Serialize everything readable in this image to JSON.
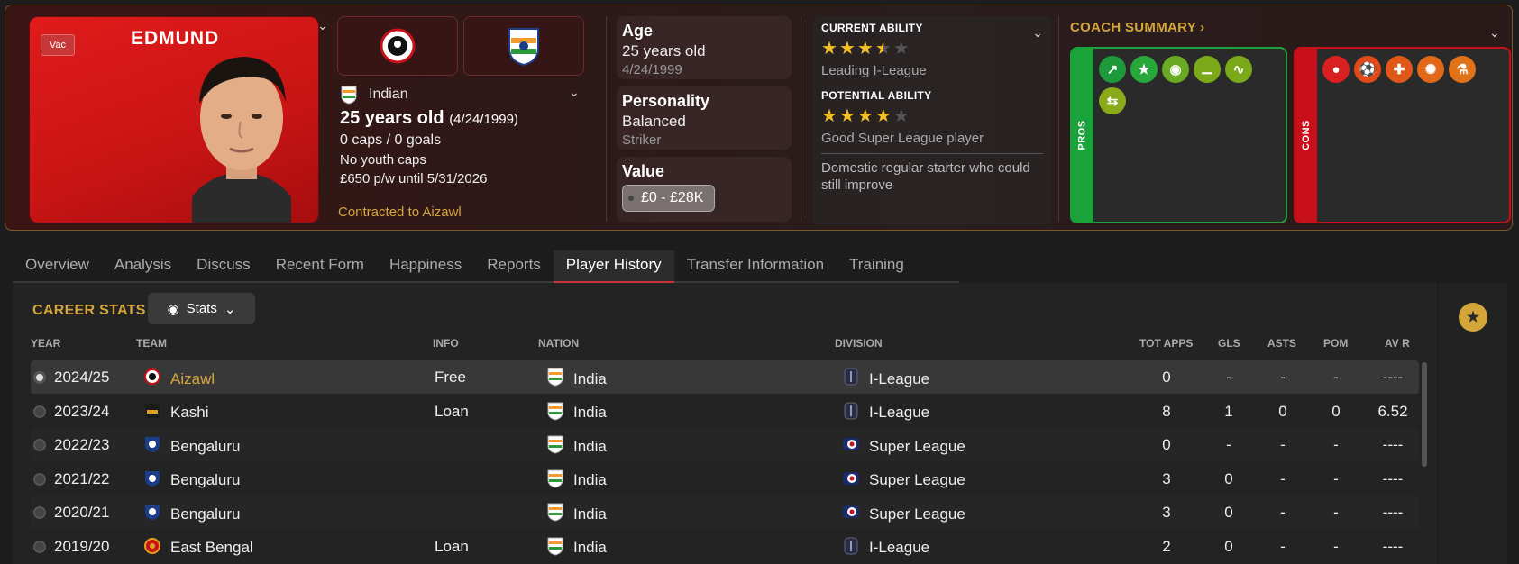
{
  "profile": {
    "name": "EDMUND",
    "vac_badge": "Vac",
    "nationality": "Indian",
    "age_line": "25 years old",
    "dob_paren": "(4/24/1999)",
    "caps_goals": "0 caps / 0 goals",
    "youth_caps": "No youth caps",
    "wage": "£650 p/w until 5/31/2026",
    "contract": "Contracted to Aizawl"
  },
  "info": {
    "age_label": "Age",
    "age_value": "25 years old",
    "dob": "4/24/1999",
    "personality_label": "Personality",
    "personality_value": "Balanced",
    "position": "Striker",
    "value_label": "Value",
    "value_range": "£0 - £28K"
  },
  "ability": {
    "current_label": "CURRENT ABILITY",
    "current_stars": 3.5,
    "current_desc": "Leading I-League",
    "potential_label": "POTENTIAL ABILITY",
    "potential_stars": 4,
    "potential_desc": "Good Super League player",
    "summary": "Domestic regular starter who could still improve"
  },
  "coach": {
    "title": "COACH SUMMARY",
    "pros_label": "PROS",
    "cons_label": "CONS",
    "pros_icons": [
      "trend-up-icon",
      "star-icon",
      "head-icon",
      "bandage-icon",
      "pulse-icon",
      "swap-icon"
    ],
    "cons_icons": [
      "ball-head-icon",
      "ball-kick-icon",
      "cross-icon",
      "burst-icon",
      "flask-icon"
    ],
    "pros_color": "#1aa33a",
    "cons_color": "#c8101a"
  },
  "tabs": [
    "Overview",
    "Analysis",
    "Discuss",
    "Recent Form",
    "Happiness",
    "Reports",
    "Player History",
    "Transfer Information",
    "Training"
  ],
  "active_tab": "Player History",
  "career": {
    "title": "CAREER STATS",
    "stats_button": "Stats",
    "columns": {
      "year": "YEAR",
      "team": "TEAM",
      "info": "INFO",
      "nation": "NATION",
      "division": "DIVISION",
      "apps": "TOT APPS",
      "gls": "GLS",
      "asts": "ASTS",
      "pom": "POM",
      "avr": "AV R"
    },
    "rows": [
      {
        "year": "2024/25",
        "team": "Aizawl",
        "info": "Free",
        "nation": "India",
        "division": "I-League",
        "apps": "0",
        "gls": "-",
        "asts": "-",
        "pom": "-",
        "avr": "----"
      },
      {
        "year": "2023/24",
        "team": "Kashi",
        "info": "Loan",
        "nation": "India",
        "division": "I-League",
        "apps": "8",
        "gls": "1",
        "asts": "0",
        "pom": "0",
        "avr": "6.52"
      },
      {
        "year": "2022/23",
        "team": "Bengaluru",
        "info": "",
        "nation": "India",
        "division": "Super League",
        "apps": "0",
        "gls": "-",
        "asts": "-",
        "pom": "-",
        "avr": "----"
      },
      {
        "year": "2021/22",
        "team": "Bengaluru",
        "info": "",
        "nation": "India",
        "division": "Super League",
        "apps": "3",
        "gls": "0",
        "asts": "-",
        "pom": "-",
        "avr": "----"
      },
      {
        "year": "2020/21",
        "team": "Bengaluru",
        "info": "",
        "nation": "India",
        "division": "Super League",
        "apps": "3",
        "gls": "0",
        "asts": "-",
        "pom": "-",
        "avr": "----"
      },
      {
        "year": "2019/20",
        "team": "East Bengal",
        "info": "Loan",
        "nation": "India",
        "division": "I-League",
        "apps": "2",
        "gls": "0",
        "asts": "-",
        "pom": "-",
        "avr": "----"
      }
    ]
  }
}
